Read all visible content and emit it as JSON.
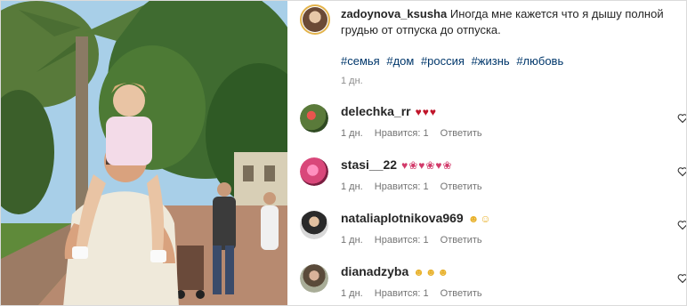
{
  "post": {
    "author": "zadoynova_ksusha",
    "text": "Иногда мне кажется что я дышу полной грудью от отпуска до отпуска.",
    "hashtags": [
      "#семья",
      "#дом",
      "#россия",
      "#жизнь",
      "#любовь"
    ],
    "time": "1 дн."
  },
  "comments": [
    {
      "username": "delechka_rr",
      "emoji": "♥♥♥",
      "time": "1 дн.",
      "likes": "Нравится: 1",
      "reply": "Ответить",
      "avatar_color": "#5a7a3a"
    },
    {
      "username": "stasi__22",
      "emoji": "♥❀♥❀♥❀",
      "time": "1 дн.",
      "likes": "Нравится: 1",
      "reply": "Ответить",
      "avatar_color": "#d9477a"
    },
    {
      "username": "nataliaplotnikova969",
      "emoji": "☻☺",
      "time": "1 дн.",
      "likes": "Нравится: 1",
      "reply": "Ответить",
      "avatar_color": "#4a4a4a"
    },
    {
      "username": "dianadzyba",
      "emoji": "☻☻☻",
      "time": "1 дн.",
      "likes": "Нравится: 1",
      "reply": "Ответить",
      "avatar_color": "#8a8f7a"
    }
  ],
  "colors": {
    "heart_red": "#c0152a",
    "stasi_flower": "#f27aa6",
    "emoji_yellow": "#e8b12b",
    "link_blue": "#00376b"
  },
  "icons": {
    "like": "heart-outline-icon"
  }
}
